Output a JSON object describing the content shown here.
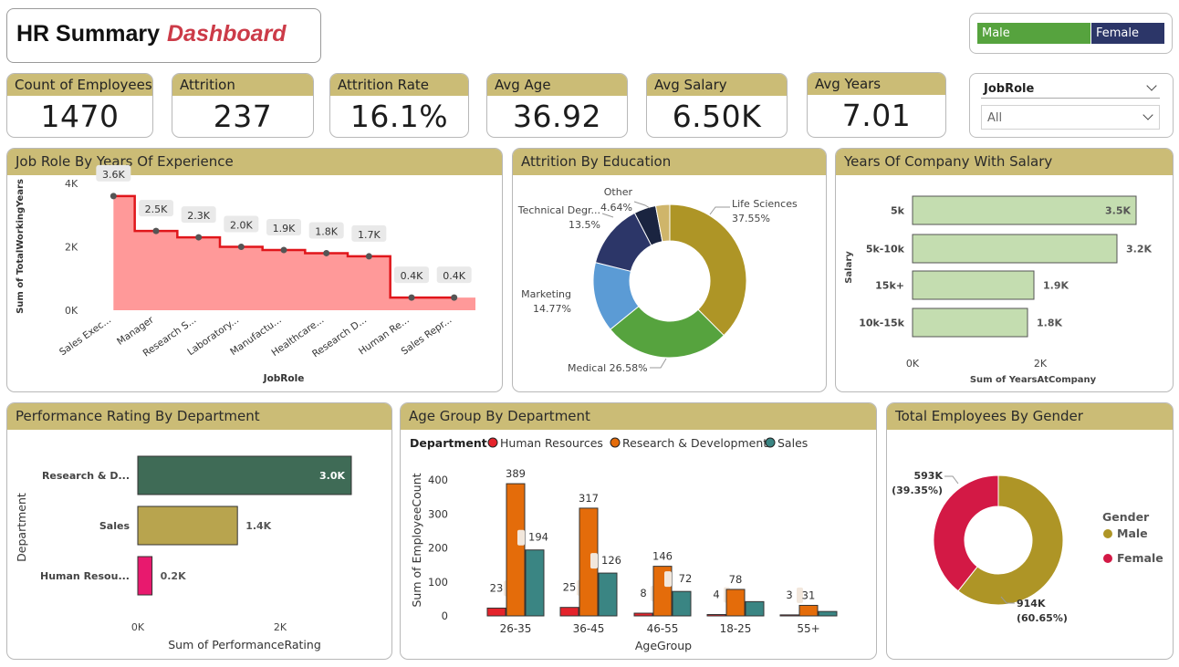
{
  "header": {
    "title": "HR Summary",
    "title_accent": "Dashboard"
  },
  "gender_legend": {
    "male": "Male",
    "female": "Female"
  },
  "kpis": [
    {
      "label": "Count of Employees",
      "value": "1470"
    },
    {
      "label": "Attrition",
      "value": "237"
    },
    {
      "label": "Attrition Rate",
      "value": "16.1%"
    },
    {
      "label": "Avg Age",
      "value": "36.92"
    },
    {
      "label": "Avg Salary",
      "value": "6.50K"
    },
    {
      "label": "Avg Years",
      "value": "7.01"
    }
  ],
  "slicer": {
    "title": "JobRole",
    "value": "All"
  },
  "panels": {
    "job_role": "Job Role By Years Of Experience",
    "education": "Attrition By Education",
    "salary": "Years Of Company With Salary",
    "performance": "Performance Rating By Department",
    "age_group": "Age Group By Department",
    "gender": "Total Employees By Gender"
  },
  "colors": {
    "accent": "#cbbc76",
    "title_accent": "#cc3b48",
    "male": "#56a33e",
    "female": "#2c3668"
  },
  "chart_data": [
    {
      "id": "job_role",
      "type": "area",
      "xlabel": "JobRole",
      "ylabel": "Sum of TotalWorkingYears",
      "yticks": [
        "0K",
        "2K",
        "4K"
      ],
      "ylim": [
        0,
        4000
      ],
      "categories": [
        "Sales Exec...",
        "Manager",
        "Research S...",
        "Laboratory...",
        "Manufactu...",
        "Healthcare...",
        "Research D...",
        "Human Re...",
        "Sales Repr..."
      ],
      "values": [
        3600,
        2500,
        2300,
        2000,
        1900,
        1800,
        1700,
        400,
        400
      ],
      "labels": [
        "3.6K",
        "2.5K",
        "2.3K",
        "2.0K",
        "1.9K",
        "1.8K",
        "1.7K",
        "0.4K",
        "0.4K"
      ]
    },
    {
      "id": "education",
      "type": "pie",
      "slices": [
        {
          "name": "Life Sciences",
          "value": 37.55,
          "label": "37.55%",
          "color": "#ae9526"
        },
        {
          "name": "Medical",
          "value": 26.58,
          "label": "26.58%",
          "color": "#56a33e"
        },
        {
          "name": "Marketing",
          "value": 14.77,
          "label": "14.77%",
          "color": "#5b9bd5"
        },
        {
          "name": "Technical Degr...",
          "value": 13.5,
          "label": "13.5%",
          "color": "#2c3668"
        },
        {
          "name": "Other",
          "value": 4.64,
          "label": "4.64%",
          "color": "#1a2440"
        },
        {
          "name": "",
          "value": 2.96,
          "label": "",
          "color": "#cfb56a"
        }
      ]
    },
    {
      "id": "salary",
      "type": "bar",
      "orientation": "horizontal",
      "xlabel": "Sum of YearsAtCompany",
      "ylabel": "Salary",
      "xticks": [
        "0K",
        "2K"
      ],
      "xlim": [
        0,
        4000
      ],
      "categories": [
        "5k",
        "5k-10k",
        "15k+",
        "10k-15k"
      ],
      "values": [
        3500,
        3200,
        1900,
        1800
      ],
      "labels": [
        "3.5K",
        "3.2K",
        "1.9K",
        "1.8K"
      ]
    },
    {
      "id": "performance",
      "type": "bar",
      "orientation": "horizontal",
      "xlabel": "Sum of PerformanceRating",
      "ylabel": "Department",
      "xticks": [
        "0K",
        "2K"
      ],
      "xlim": [
        0,
        4000
      ],
      "categories": [
        "Research & D...",
        "Sales",
        "Human Resou..."
      ],
      "values": [
        3000,
        1400,
        200
      ],
      "labels": [
        "3.0K",
        "1.4K",
        "0.2K"
      ],
      "colors": [
        "#3f6b56",
        "#b8a44e",
        "#e8196e"
      ]
    },
    {
      "id": "age_group",
      "type": "bar",
      "xlabel": "AgeGroup",
      "ylabel": "Sum of EmployeeCount",
      "legend_title": "Department",
      "yticks": [
        "0",
        "100",
        "200",
        "300",
        "400"
      ],
      "ylim": [
        0,
        400
      ],
      "categories": [
        "26-35",
        "36-45",
        "46-55",
        "18-25",
        "55+"
      ],
      "series": [
        {
          "name": "Human Resources",
          "color": "#e4232b",
          "values": [
            23,
            25,
            8,
            4,
            3
          ]
        },
        {
          "name": "Research & Development",
          "color": "#e46c0a",
          "values": [
            389,
            317,
            146,
            78,
            31
          ]
        },
        {
          "name": "Sales",
          "color": "#3a8583",
          "values": [
            194,
            126,
            72,
            42,
            13
          ]
        }
      ],
      "value_labels": {
        "Human Resources": [
          "23",
          "25",
          "8",
          "4",
          "3"
        ],
        "Research & Development": [
          "389",
          "317",
          "146",
          "78",
          "31"
        ],
        "Sales": [
          "194",
          "126",
          "72",
          "",
          ""
        ]
      }
    },
    {
      "id": "gender",
      "type": "pie",
      "legend_title": "Gender",
      "slices": [
        {
          "name": "Male",
          "value": 60.65,
          "label": "914K",
          "pct": "(60.65%)",
          "color": "#ae9526"
        },
        {
          "name": "Female",
          "value": 39.35,
          "label": "593K",
          "pct": "(39.35%)",
          "color": "#d31945"
        }
      ]
    }
  ]
}
